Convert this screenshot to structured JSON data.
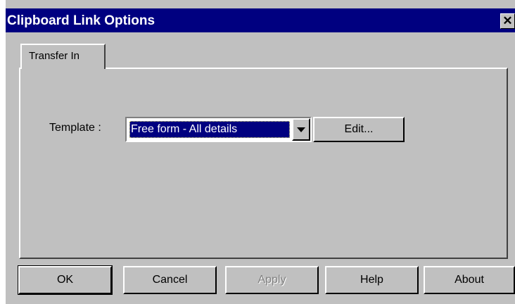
{
  "window": {
    "title": "Clipboard Link Options",
    "close_glyph": "✕"
  },
  "tabs": [
    {
      "label": "Transfer In",
      "active": true
    }
  ],
  "form": {
    "template_label": "Template :",
    "template_value": "Free form - All details",
    "edit_label": "Edit..."
  },
  "buttons": {
    "ok": "OK",
    "cancel": "Cancel",
    "apply": "Apply",
    "apply_enabled": false,
    "help": "Help",
    "about": "About"
  },
  "colors": {
    "titlebar": "#000080",
    "face": "#c0c0c0",
    "selection": "#000080"
  },
  "icons": [
    "close-icon",
    "dropdown-arrow-icon"
  ]
}
